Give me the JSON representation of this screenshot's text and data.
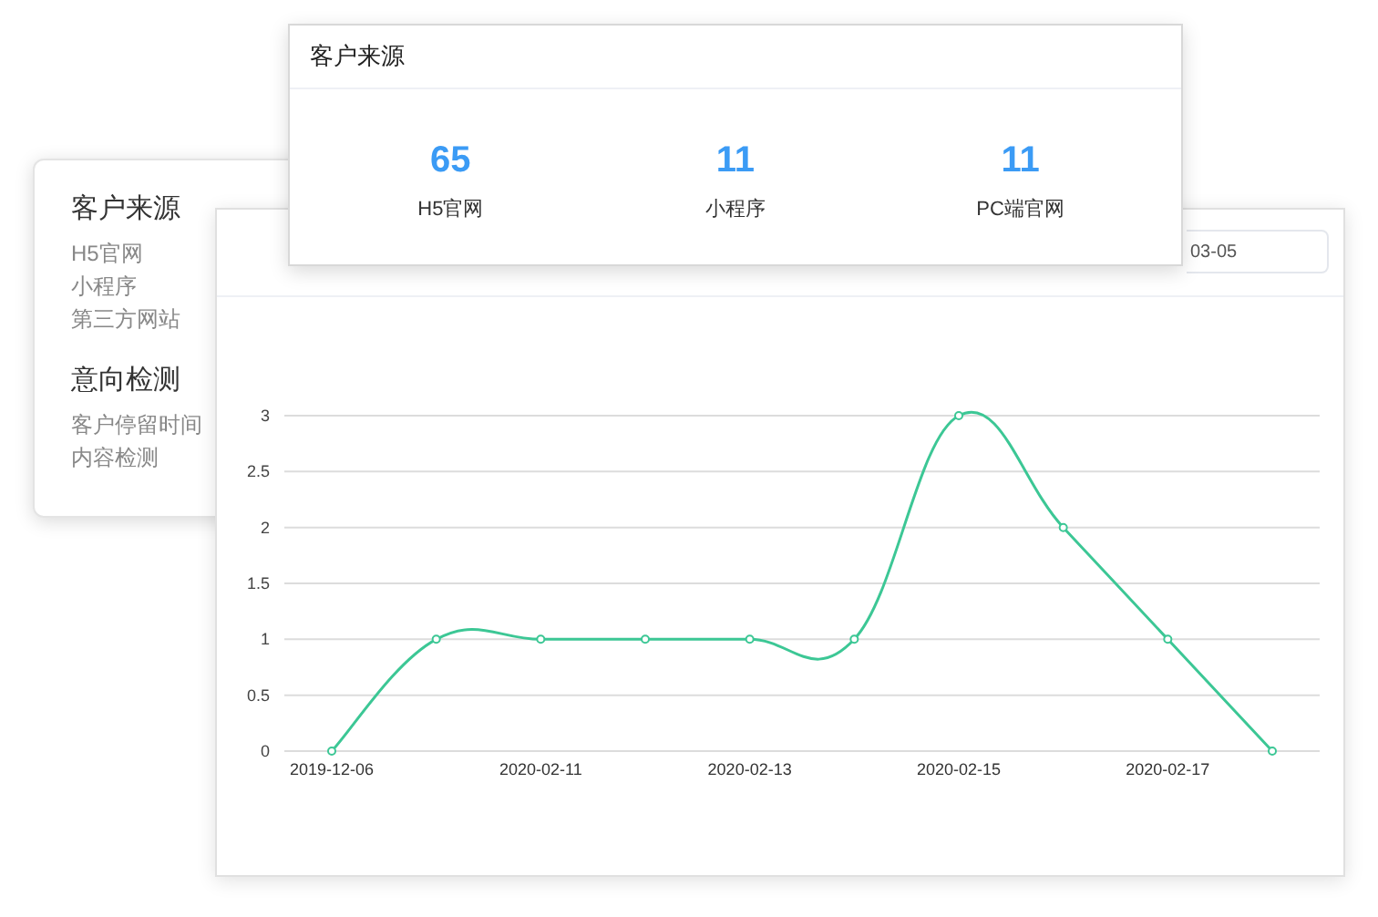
{
  "menu_card": {
    "sections": [
      {
        "title": "客户来源",
        "items": [
          "H5官网",
          "小程序",
          "第三方网站"
        ]
      },
      {
        "title": "意向检测",
        "items": [
          "客户停留时间",
          "内容检测"
        ]
      }
    ]
  },
  "source_card": {
    "title": "客户来源",
    "stats": [
      {
        "value": "65",
        "label": "H5官网"
      },
      {
        "value": "11",
        "label": "小程序"
      },
      {
        "value": "11",
        "label": "PC端官网"
      }
    ]
  },
  "chart_card": {
    "date_field": {
      "value": "03-05"
    },
    "chart_data": {
      "type": "line",
      "categories": [
        "2019-12-06",
        null,
        "2020-02-11",
        null,
        "2020-02-13",
        null,
        "2020-02-15",
        null,
        "2020-02-17",
        null
      ],
      "series": [
        {
          "color": "#3cc795",
          "marker": true,
          "values": [
            0,
            1,
            1,
            1,
            1,
            1,
            3,
            2,
            1,
            0
          ]
        }
      ],
      "grid": true,
      "ylim": [
        0,
        3
      ],
      "yticks": [
        0,
        0.5,
        1,
        1.5,
        2,
        2.5,
        3
      ]
    }
  }
}
